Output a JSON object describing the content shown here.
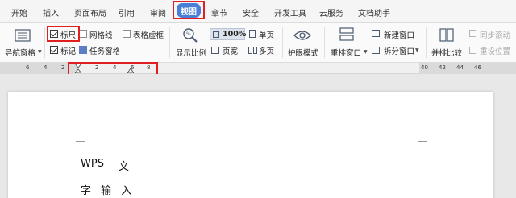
{
  "menu": {
    "tabs": [
      "开始",
      "插入",
      "页面布局",
      "引用",
      "审阅",
      "视图",
      "章节",
      "安全",
      "开发工具",
      "云服务",
      "文档助手"
    ],
    "active_tab": "视图"
  },
  "ribbon": {
    "nav_pane": "导航窗格",
    "ruler": {
      "label": "标尺",
      "checked": true
    },
    "gridlines": {
      "label": "网格线",
      "checked": false
    },
    "table_gridlines": {
      "label": "表格虚框",
      "checked": false
    },
    "marks": {
      "label": "标记",
      "checked": true
    },
    "task_pane": {
      "label": "任务窗格",
      "checked": false
    },
    "zoom": "显示比例",
    "zoom_value": "100%",
    "single_page": "单页",
    "page_width": "页宽",
    "multi_page": "多页",
    "eye_mode": "护眼模式",
    "arrange_window": "重排窗口",
    "new_window": "新建窗口",
    "split_window": "拆分窗口",
    "side_by_side": "并排比较",
    "sync_scroll": "同步滚动",
    "reset_position": "重设位置"
  },
  "ruler": {
    "ticks_left": [
      "6",
      "4",
      "2"
    ],
    "ticks_mid": [
      "2",
      "4",
      "6",
      "8"
    ],
    "ticks_right": [
      "40",
      "42",
      "44",
      "46"
    ]
  },
  "document": {
    "line1_a": "WPS",
    "line1_b": "文",
    "line2": "字 输 入"
  },
  "colors": {
    "accent": "#4a7fd8",
    "highlight_box": "#e02020"
  }
}
